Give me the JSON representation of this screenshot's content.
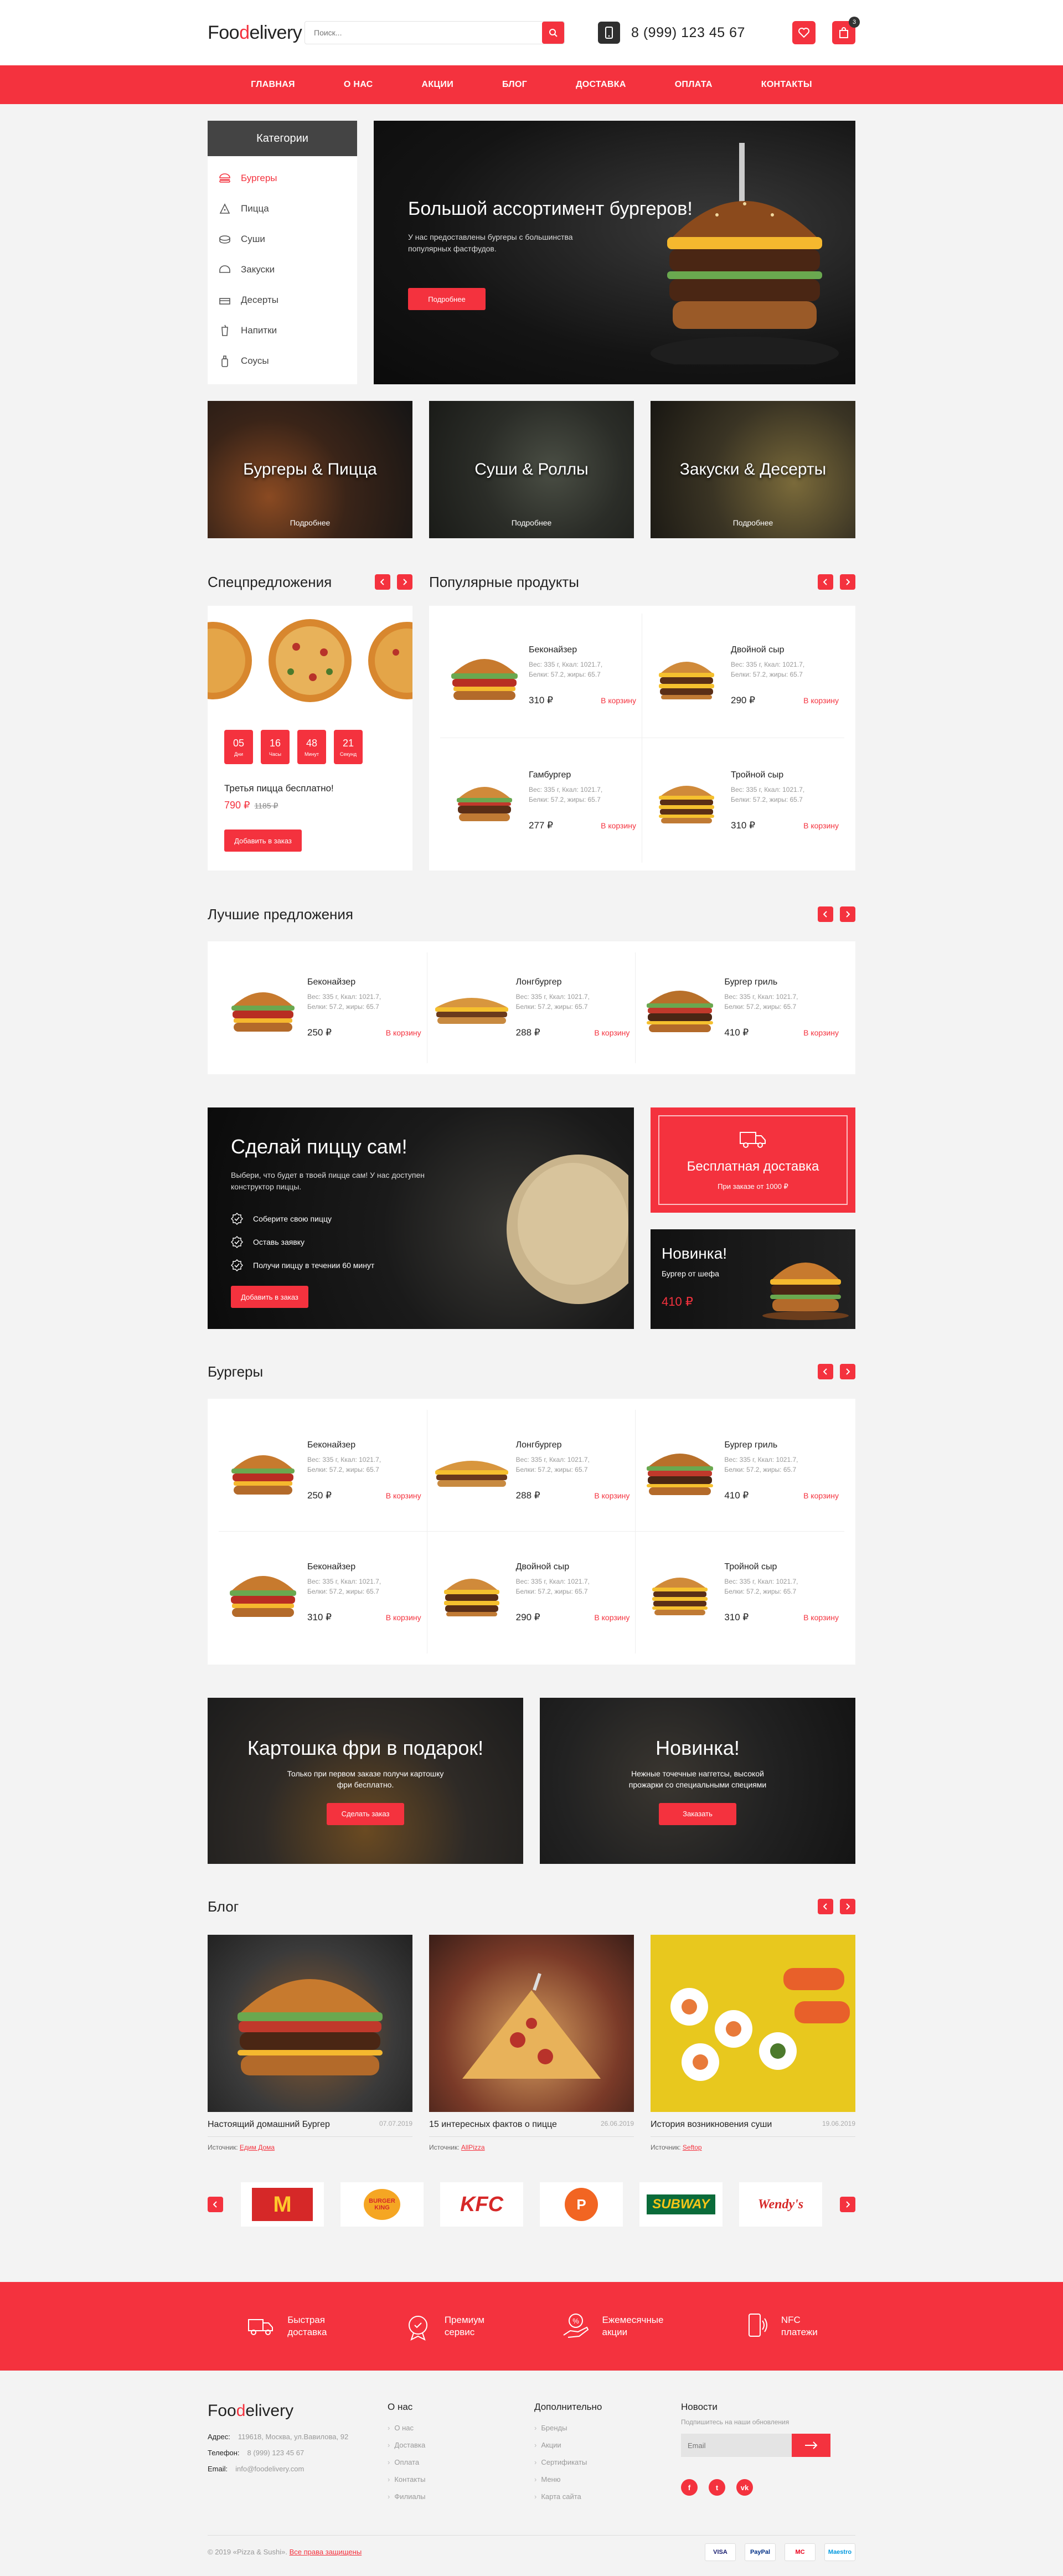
{
  "header": {
    "logo_part1": "Foo",
    "logo_part2": "d",
    "logo_part3": "elivery",
    "search_placeholder": "Поиск...",
    "phone": "8 (999) 123 45 67",
    "cart_count": "3"
  },
  "nav": [
    "ГЛАВНАЯ",
    "О НАС",
    "АКЦИИ",
    "БЛОГ",
    "ДОСТАВКА",
    "ОПЛАТА",
    "КОНТАКТЫ"
  ],
  "categories": {
    "title": "Категории",
    "items": [
      "Бургеры",
      "Пицца",
      "Суши",
      "Закуски",
      "Десерты",
      "Напитки",
      "Соусы"
    ]
  },
  "hero": {
    "title": "Большой ассортимент бургеров!",
    "text": "У нас предоставлены бургеры с большинства популярных фастфудов.",
    "button": "Подробнее"
  },
  "tiles": [
    {
      "title": "Бургеры & Пицца",
      "more": "Подробнее"
    },
    {
      "title": "Суши & Роллы",
      "more": "Подробнее"
    },
    {
      "title": "Закуски & Десерты",
      "more": "Подробнее"
    }
  ],
  "special": {
    "title": "Спецпредложения",
    "timer": [
      {
        "v": "05",
        "l": "Дни"
      },
      {
        "v": "16",
        "l": "Часы"
      },
      {
        "v": "48",
        "l": "Минут"
      },
      {
        "v": "21",
        "l": "Секунд"
      }
    ],
    "offer": "Третья пицца бесплатно!",
    "price": "790 ₽",
    "old_price": "1185 ₽",
    "button": "Добавить в заказ"
  },
  "popular": {
    "title": "Популярные продукты",
    "items": [
      {
        "name": "Беконайзер",
        "desc1": "Вес: 335 г, Ккал: 1021.7,",
        "desc2": "Белки: 57.2, жиры: 65.7",
        "price": "310 ₽",
        "cart": "В корзину"
      },
      {
        "name": "Двойной сыр",
        "desc1": "Вес: 335 г, Ккал: 1021.7,",
        "desc2": "Белки: 57.2, жиры: 65.7",
        "price": "290 ₽",
        "cart": "В корзину"
      },
      {
        "name": "Гамбургер",
        "desc1": "Вес: 335 г, Ккал: 1021.7,",
        "desc2": "Белки: 57.2, жиры: 65.7",
        "price": "277 ₽",
        "cart": "В корзину"
      },
      {
        "name": "Тройной сыр",
        "desc1": "Вес: 335 г, Ккал: 1021.7,",
        "desc2": "Белки: 57.2, жиры: 65.7",
        "price": "310 ₽",
        "cart": "В корзину"
      }
    ]
  },
  "best": {
    "title": "Лучшие предложения",
    "items": [
      {
        "name": "Беконайзер",
        "desc1": "Вес: 335 г, Ккал: 1021.7,",
        "desc2": "Белки: 57.2, жиры: 65.7",
        "price": "250 ₽",
        "cart": "В корзину"
      },
      {
        "name": "Лонгбургер",
        "desc1": "Вес: 335 г, Ккал: 1021.7,",
        "desc2": "Белки: 57.2, жиры: 65.7",
        "price": "288 ₽",
        "cart": "В корзину"
      },
      {
        "name": "Бургер гриль",
        "desc1": "Вес: 335 г, Ккал: 1021.7,",
        "desc2": "Белки: 57.2, жиры: 65.7",
        "price": "410 ₽",
        "cart": "В корзину"
      }
    ]
  },
  "pizza_promo": {
    "title": "Сделай пиццу сам!",
    "text": "Выбери, что будет в твоей пицце сам! У нас доступен конструктор пиццы.",
    "steps": [
      "Соберите свою пиццу",
      "Оставь заявку",
      "Получи пиццу в течении 60 минут"
    ],
    "button": "Добавить в заказ"
  },
  "delivery": {
    "title": "Бесплатная доставка",
    "sub": "При заказе от 1000 ₽"
  },
  "novinka_small": {
    "title": "Новинка!",
    "sub": "Бургер от шефа",
    "price": "410 ₽"
  },
  "burgers": {
    "title": "Бургеры",
    "items": [
      {
        "name": "Беконайзер",
        "desc1": "Вес: 335 г, Ккал: 1021.7,",
        "desc2": "Белки: 57.2, жиры: 65.7",
        "price": "250 ₽",
        "cart": "В корзину"
      },
      {
        "name": "Лонгбургер",
        "desc1": "Вес: 335 г, Ккал: 1021.7,",
        "desc2": "Белки: 57.2, жиры: 65.7",
        "price": "288 ₽",
        "cart": "В корзину"
      },
      {
        "name": "Бургер гриль",
        "desc1": "Вес: 335 г, Ккал: 1021.7,",
        "desc2": "Белки: 57.2, жиры: 65.7",
        "price": "410 ₽",
        "cart": "В корзину"
      },
      {
        "name": "Беконайзер",
        "desc1": "Вес: 335 г, Ккал: 1021.7,",
        "desc2": "Белки: 57.2, жиры: 65.7",
        "price": "310 ₽",
        "cart": "В корзину"
      },
      {
        "name": "Двойной сыр",
        "desc1": "Вес: 335 г, Ккал: 1021.7,",
        "desc2": "Белки: 57.2, жиры: 65.7",
        "price": "290 ₽",
        "cart": "В корзину"
      },
      {
        "name": "Тройной сыр",
        "desc1": "Вес: 335 г, Ккал: 1021.7,",
        "desc2": "Белки: 57.2, жиры: 65.7",
        "price": "310 ₽",
        "cart": "В корзину"
      }
    ]
  },
  "promo_fries": {
    "title": "Картошка фри в подарок!",
    "text": "Только при первом заказе получи картошку фри бесплатно.",
    "button": "Сделать заказ"
  },
  "promo_nuggets": {
    "title": "Новинка!",
    "text": "Нежные точечные наггетсы, высокой прожарки со специальными специями",
    "button": "Заказать"
  },
  "blog": {
    "title": "Блог",
    "source_label": "Источник:",
    "items": [
      {
        "title": "Настоящий домашний Бургер",
        "date": "07.07.2019",
        "source": "Едим Дома"
      },
      {
        "title": "15 интересных фактов о пицце",
        "date": "26.06.2019",
        "source": "AllPizza"
      },
      {
        "title": "История возникновения суши",
        "date": "19.06.2019",
        "source": "Seftop"
      }
    ]
  },
  "brands": [
    "M",
    "BURGER KING",
    "KFC",
    "P",
    "SUBWAY",
    "Wendy's"
  ],
  "features": [
    {
      "l1": "Быстрая",
      "l2": "доставка"
    },
    {
      "l1": "Премиум",
      "l2": "сервис"
    },
    {
      "l1": "Ежемесячные",
      "l2": "акции"
    },
    {
      "l1": "NFC",
      "l2": "платежи"
    }
  ],
  "footer": {
    "address_label": "Адрес:",
    "address": "119618, Москва, ул.Вавилова, 92",
    "phone_label": "Телефон:",
    "phone": "8 (999) 123 45 67",
    "email_label": "Email:",
    "email": "info@foodelivery.com",
    "about_title": "О нас",
    "about_links": [
      "О нас",
      "Доставка",
      "Оплата",
      "Контакты",
      "Филиалы"
    ],
    "extra_title": "Дополнительно",
    "extra_links": [
      "Бренды",
      "Акции",
      "Сертификаты",
      "Меню",
      "Карта сайта"
    ],
    "news_title": "Новости",
    "news_sub": "Подпишитесь на наши обновления",
    "email_placeholder": "Email",
    "social": [
      "f",
      "t",
      "vk"
    ],
    "copyright": "© 2019 «Pizza & Sushi».",
    "rights": "Все права защищены",
    "payments": [
      "VISA",
      "PayPal",
      "MC",
      "Maestro"
    ]
  },
  "colors": {
    "accent": "#f4323e",
    "dark": "#2f2f2f"
  }
}
